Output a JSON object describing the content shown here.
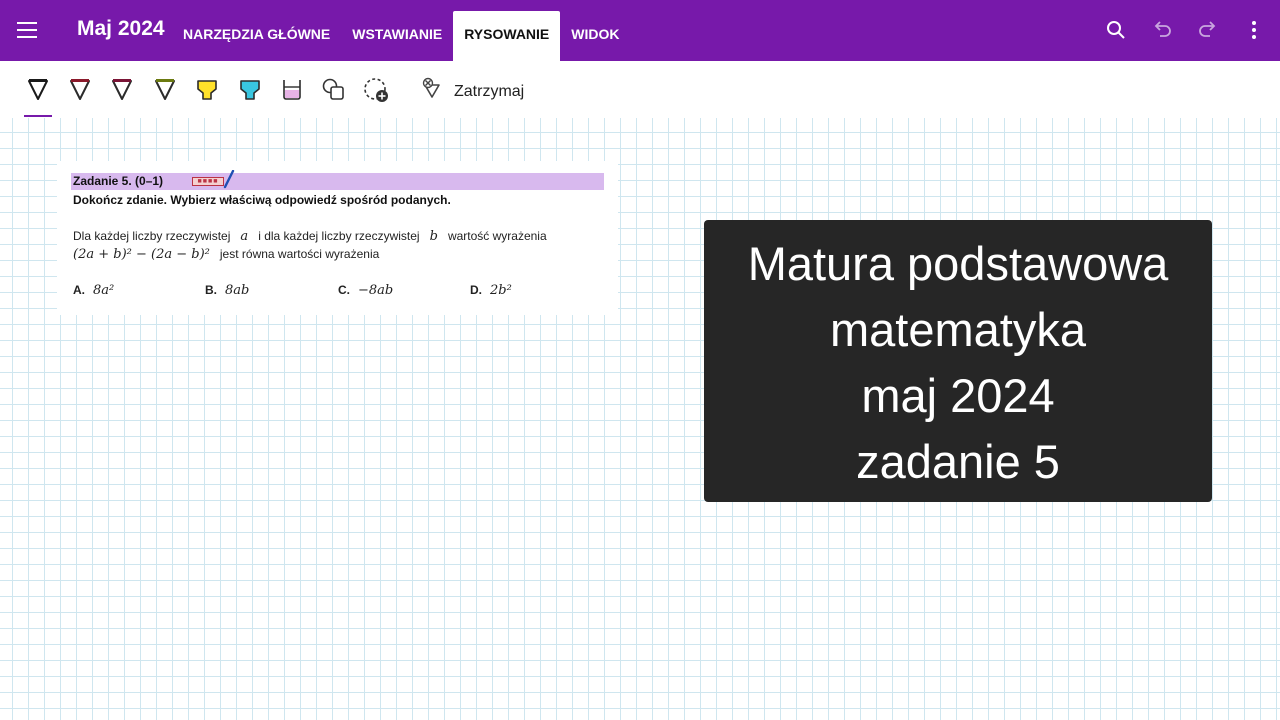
{
  "app": {
    "title": "Maj 2024",
    "accent_color": "#7719aa"
  },
  "tabs": [
    {
      "label": "NARZĘDZIA GŁÓWNE",
      "active": false
    },
    {
      "label": "WSTAWIANIE",
      "active": false
    },
    {
      "label": "RYSOWANIE",
      "active": true
    },
    {
      "label": "WIDOK",
      "active": false
    }
  ],
  "top_icons": [
    "search-icon",
    "undo-icon",
    "redo-icon",
    "more-icon"
  ],
  "ribbon": {
    "tools": [
      {
        "name": "pen-black",
        "color": "#1a1a1a"
      },
      {
        "name": "pen-dark-red",
        "color": "#8b1a2b"
      },
      {
        "name": "pen-maroon",
        "color": "#7a1436"
      },
      {
        "name": "pen-olive",
        "color": "#6b7a10"
      },
      {
        "name": "highlighter-yellow",
        "color": "#ffe12a"
      },
      {
        "name": "highlighter-cyan",
        "color": "#39c6e0"
      },
      {
        "name": "highlighter-pink",
        "color": "#e7b3e6"
      },
      {
        "name": "shapes",
        "color": "#333333"
      },
      {
        "name": "lasso-add",
        "color": "#333333"
      }
    ],
    "stop_label": "Zatrzymaj"
  },
  "excerpt": {
    "header": "Zadanie 5. (0–1)",
    "instruction": "Dokończ zdanie. Wybierz właściwą odpowiedź spośród podanych.",
    "body_part1": "Dla każdej liczby rzeczywistej",
    "var_a": "a",
    "body_part2": "i dla każdej liczby rzeczywistej",
    "var_b": "b",
    "body_part3": "wartość wyrażenia",
    "expression": "(2a + b)² − (2a − b)²",
    "body_part4": "jest równa wartości wyrażenia",
    "options": [
      {
        "letter": "A.",
        "value": "8a²"
      },
      {
        "letter": "B.",
        "value": "8ab"
      },
      {
        "letter": "C.",
        "value": "−8ab"
      },
      {
        "letter": "D.",
        "value": "2b²"
      }
    ]
  },
  "card": {
    "lines": [
      "Matura podstawowa",
      "matematyka",
      "maj 2024",
      "zadanie 5"
    ]
  }
}
